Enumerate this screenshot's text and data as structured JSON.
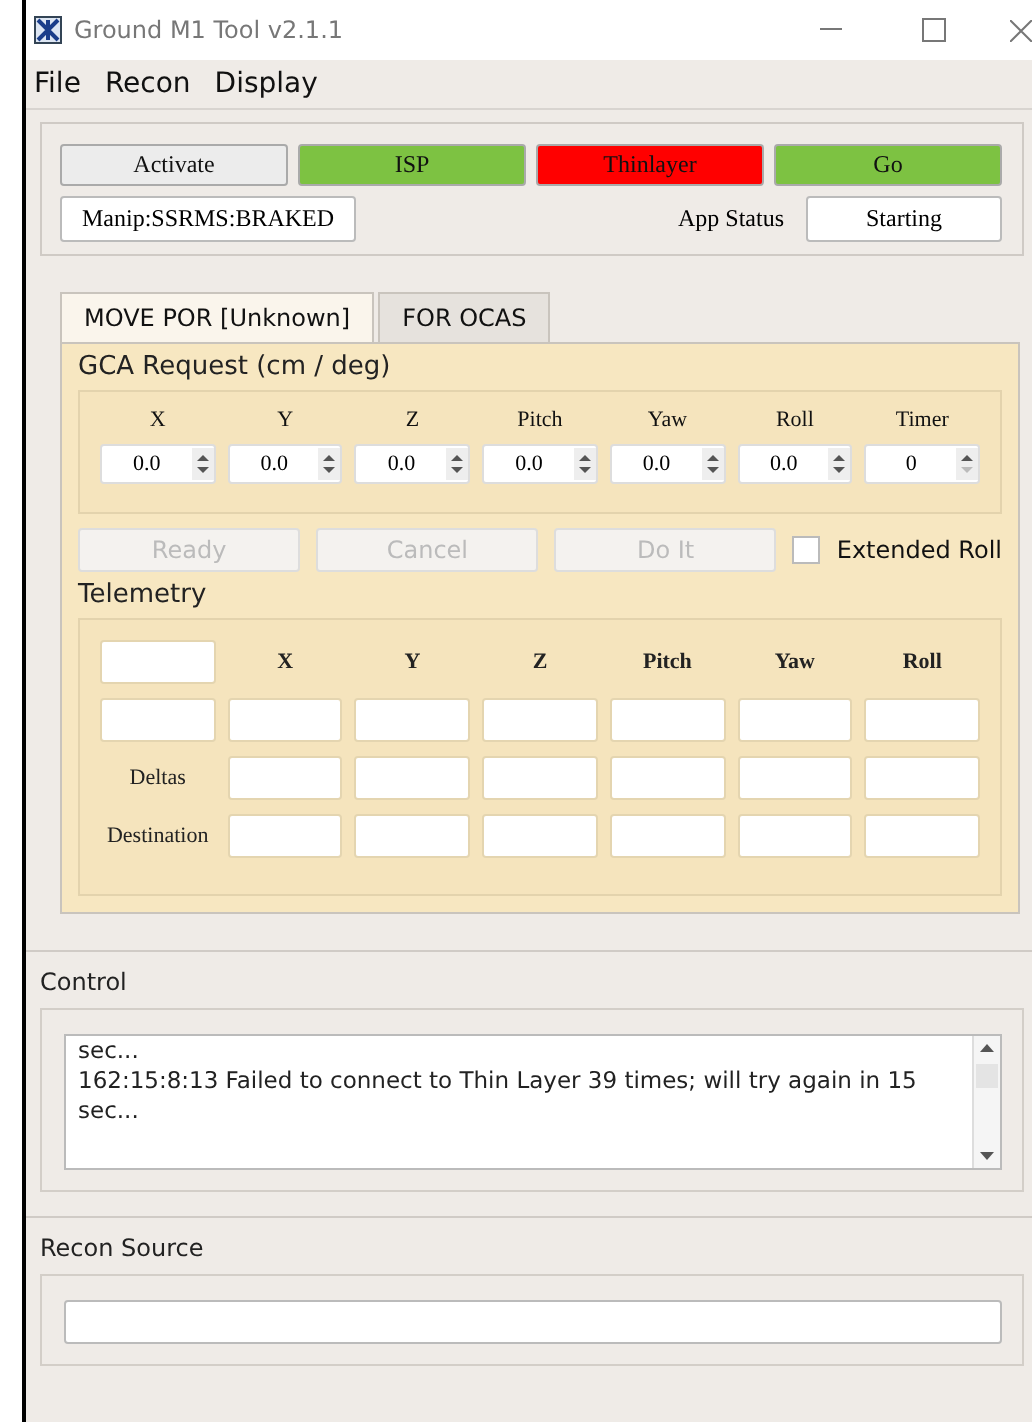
{
  "window": {
    "title": "Ground M1 Tool v2.1.1"
  },
  "menu": [
    {
      "label": "File"
    },
    {
      "label": "Recon"
    },
    {
      "label": "Display"
    }
  ],
  "status_buttons": [
    {
      "label": "Activate",
      "color": "#ececec"
    },
    {
      "label": "ISP",
      "color": "#7dc242"
    },
    {
      "label": "Thinlayer",
      "color": "#ff0000"
    },
    {
      "label": "Go",
      "color": "#7dc242"
    }
  ],
  "manip_status": "Manip:SSRMS:BRAKED",
  "app_status": {
    "label": "App Status",
    "value": "Starting"
  },
  "tabs": [
    {
      "label": "MOVE POR [Unknown]",
      "selected": true
    },
    {
      "label": "FOR OCAS",
      "selected": false
    }
  ],
  "gca_request": {
    "title": "GCA Request (cm / deg)",
    "fields": [
      {
        "label": "X",
        "value": "0.0"
      },
      {
        "label": "Y",
        "value": "0.0"
      },
      {
        "label": "Z",
        "value": "0.0"
      },
      {
        "label": "Pitch",
        "value": "0.0"
      },
      {
        "label": "Yaw",
        "value": "0.0"
      },
      {
        "label": "Roll",
        "value": "0.0"
      },
      {
        "label": "Timer",
        "value": "0",
        "at_minimum": true
      }
    ]
  },
  "actions": [
    {
      "label": "Ready",
      "disabled": true
    },
    {
      "label": "Cancel",
      "disabled": true
    },
    {
      "label": "Do It",
      "disabled": true
    }
  ],
  "extended_roll": {
    "label": "Extended Roll",
    "checked": false
  },
  "telemetry": {
    "title": "Telemetry",
    "columns": [
      "X",
      "Y",
      "Z",
      "Pitch",
      "Yaw",
      "Roll"
    ],
    "rows": [
      {
        "kind": "field"
      },
      {
        "kind": "label",
        "label": "Deltas"
      },
      {
        "kind": "label",
        "label": "Destination"
      }
    ]
  },
  "control": {
    "title": "Control",
    "log": [
      "sec...",
      "162:15:8:13 Failed to connect to Thin Layer 39 times; will try again in 15 sec..."
    ]
  },
  "recon_source": {
    "title": "Recon Source"
  }
}
